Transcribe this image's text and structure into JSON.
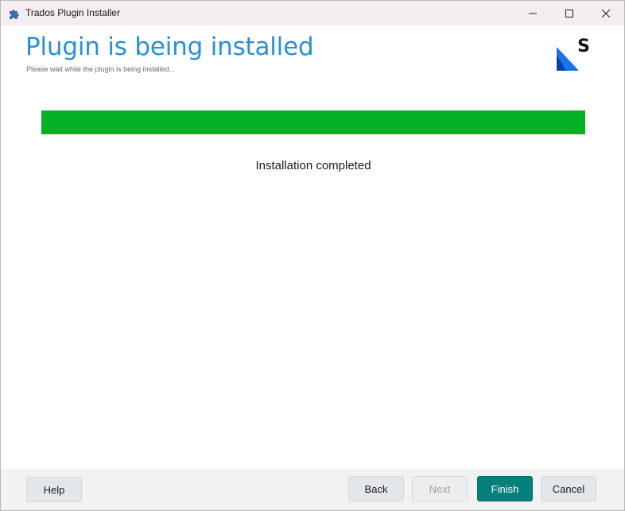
{
  "window": {
    "title": "Trados Plugin Installer",
    "controls": {
      "minimize_icon": "minimize-icon",
      "maximize_icon": "maximize-icon",
      "close_icon": "close-icon"
    }
  },
  "header": {
    "title": "Plugin is being installed",
    "subtitle": "Please wait while the plugin is being installed..."
  },
  "progress": {
    "value_percent": 100,
    "color": "#06b025"
  },
  "status_text": "Installation completed",
  "footer": {
    "help_label": "Help",
    "back_label": "Back",
    "next_label": "Next",
    "finish_label": "Finish",
    "cancel_label": "Cancel"
  },
  "colors": {
    "accent": "#2b8fd6",
    "finish_button": "#06807a"
  }
}
